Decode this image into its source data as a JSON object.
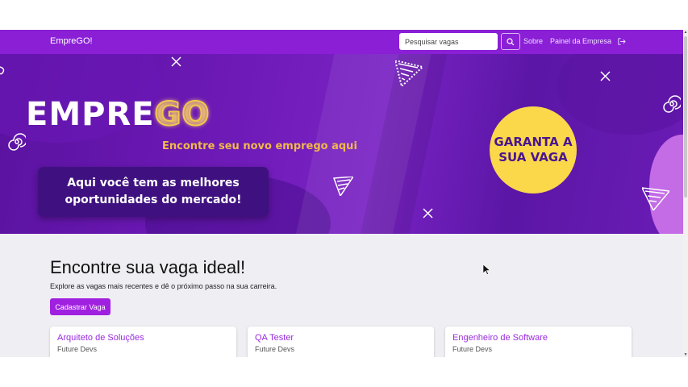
{
  "navbar": {
    "brand": "EmpreGO!",
    "search_placeholder": "Pesquisar vagas",
    "links": [
      "Sobre",
      "Painel da Empresa"
    ]
  },
  "banner": {
    "logo_left": "EMPRE",
    "logo_right": "GO",
    "tagline": "Encontre seu novo emprego aqui",
    "promo": "Aqui você tem as melhores oportunidades do mercado!",
    "cta": "GARANTA A SUA VAGA"
  },
  "main": {
    "title": "Encontre sua vaga ideal!",
    "subtitle": "Explore as vagas mais recentes e dê o próximo passo na sua carreira.",
    "register_button": "Cadastrar Vaga",
    "jobs": [
      {
        "title": "Arquiteto de Soluções",
        "company": "Future Devs"
      },
      {
        "title": "QA Tester",
        "company": "Future Devs"
      },
      {
        "title": "Engenheiro de Software",
        "company": "Future Devs"
      }
    ]
  },
  "colors": {
    "navbar": "#8a1fd6",
    "banner_purple": "#6e1ab8",
    "accent_yellow": "#fbd84a",
    "job_title": "#9b2bdd"
  },
  "icons": [
    "search-icon",
    "logout-icon",
    "close-x-icon",
    "spiral-icon",
    "cursor-icon"
  ]
}
